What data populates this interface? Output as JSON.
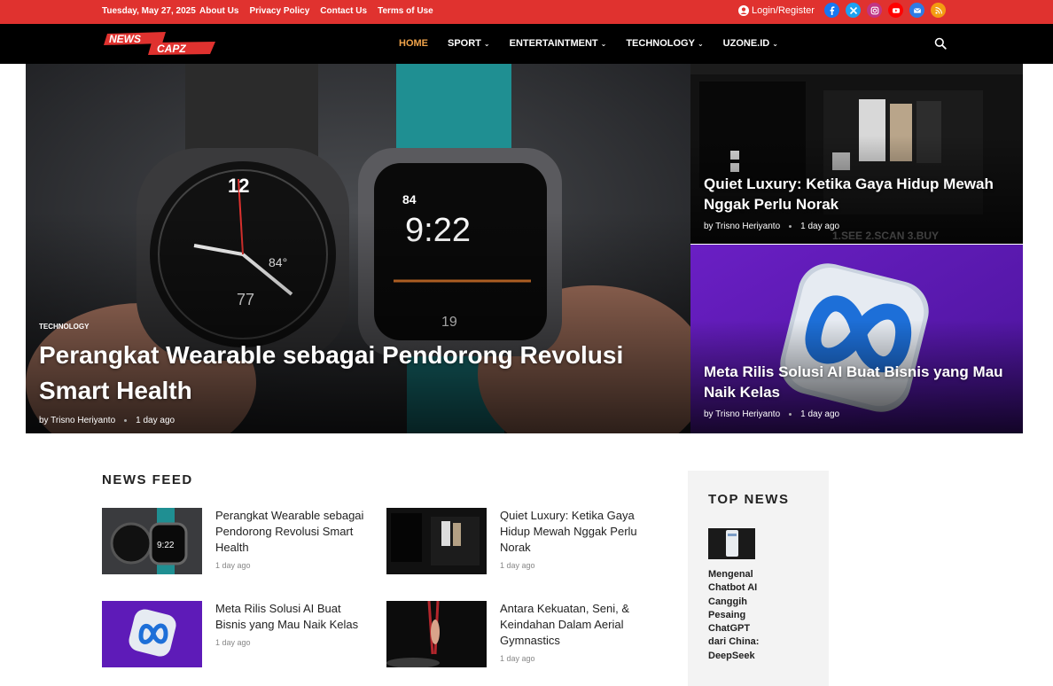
{
  "topbar": {
    "date": "Tuesday, May 27, 2025",
    "links": [
      "About Us",
      "Privacy Policy",
      "Contact Us",
      "Terms of Use"
    ],
    "login": "Login/Register",
    "socials": [
      {
        "name": "facebook-icon",
        "color": "#1877f2"
      },
      {
        "name": "twitter-icon",
        "color": "#1da1f2"
      },
      {
        "name": "instagram-icon",
        "color": "#c13584"
      },
      {
        "name": "youtube-icon",
        "color": "#ff0000"
      },
      {
        "name": "email-icon",
        "color": "#2d7be5"
      },
      {
        "name": "rss-icon",
        "color": "#f39c12"
      }
    ]
  },
  "nav": {
    "logo": "NEWS CAPZ",
    "menu": [
      {
        "label": "HOME",
        "active": true,
        "dropdown": false
      },
      {
        "label": "SPORT",
        "dropdown": true
      },
      {
        "label": "ENTERTAINTMENT",
        "dropdown": true
      },
      {
        "label": "TECHNOLOGY",
        "dropdown": true
      },
      {
        "label": "UZONE.ID",
        "dropdown": true
      }
    ]
  },
  "hero": {
    "main": {
      "category": "TECHNOLOGY",
      "title": "Perangkat Wearable sebagai Pendorong Revolusi Smart Health",
      "author": "by Trisno Heriyanto",
      "time": "1 day ago"
    },
    "side1": {
      "title": "Quiet Luxury: Ketika Gaya Hidup Mewah Nggak Perlu Norak",
      "author": "by Trisno Heriyanto",
      "time": "1 day ago"
    },
    "side2": {
      "title": "Meta Rilis Solusi AI Buat Bisnis yang Mau Naik Kelas",
      "author": "by Trisno Heriyanto",
      "time": "1 day ago"
    }
  },
  "newsfeed": {
    "heading": "NEWS FEED",
    "items": [
      {
        "title": "Perangkat Wearable sebagai Pendorong Revolusi Smart Health",
        "time": "1 day ago"
      },
      {
        "title": "Quiet Luxury: Ketika Gaya Hidup Mewah Nggak Perlu Norak",
        "time": "1 day ago"
      },
      {
        "title": "Meta Rilis Solusi AI Buat Bisnis yang Mau Naik Kelas",
        "time": "1 day ago"
      },
      {
        "title": "Antara Kekuatan, Seni, & Keindahan Dalam Aerial Gymnastics",
        "time": "1 day ago"
      }
    ]
  },
  "topnews": {
    "heading": "TOP NEWS",
    "item": "Mengenal Chatbot AI Canggih Pesaing ChatGPT dari China: DeepSeek"
  }
}
